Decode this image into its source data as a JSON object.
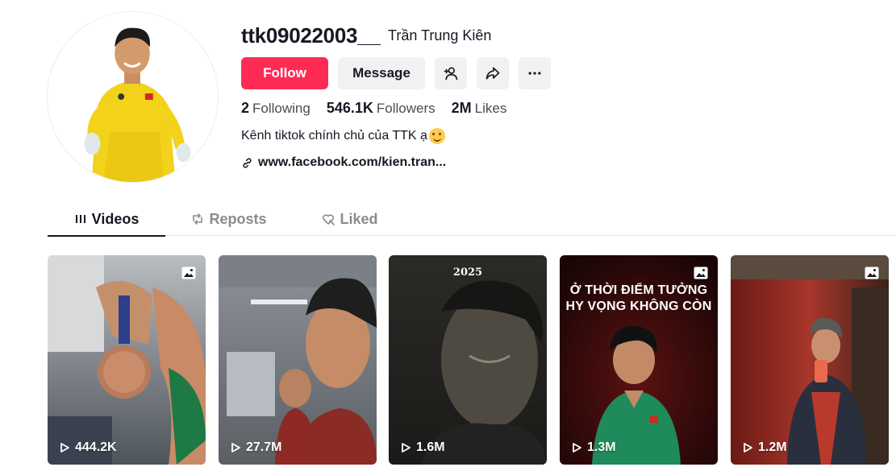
{
  "profile": {
    "username": "ttk09022003__",
    "nickname": "Trần Trung Kiên",
    "bio": "Kênh tiktok chính chủ của TTK ạ",
    "link": "www.facebook.com/kien.tran..."
  },
  "actions": {
    "follow": "Follow",
    "message": "Message"
  },
  "stats": [
    {
      "value": "2",
      "label": "Following"
    },
    {
      "value": "546.1K",
      "label": "Followers"
    },
    {
      "value": "2M",
      "label": "Likes"
    }
  ],
  "tabs": [
    {
      "label": "Videos",
      "active": true
    },
    {
      "label": "Reposts",
      "active": false
    },
    {
      "label": "Liked",
      "active": false
    }
  ],
  "videos": [
    {
      "views": "444.2K",
      "is_photo": true
    },
    {
      "views": "27.7M",
      "is_photo": false
    },
    {
      "views": "1.6M",
      "is_photo": false,
      "overlay_title": "2025"
    },
    {
      "views": "1.3M",
      "is_photo": true,
      "overlay_line1": "Ở THỜI ĐIỂM TƯỞNG",
      "overlay_line2": "HY VỌNG KHÔNG CÒN"
    },
    {
      "views": "1.2M",
      "is_photo": true
    }
  ],
  "colors": {
    "accent": "#fe2c55",
    "text": "#161823",
    "secondary_bg": "#f1f1f2"
  }
}
